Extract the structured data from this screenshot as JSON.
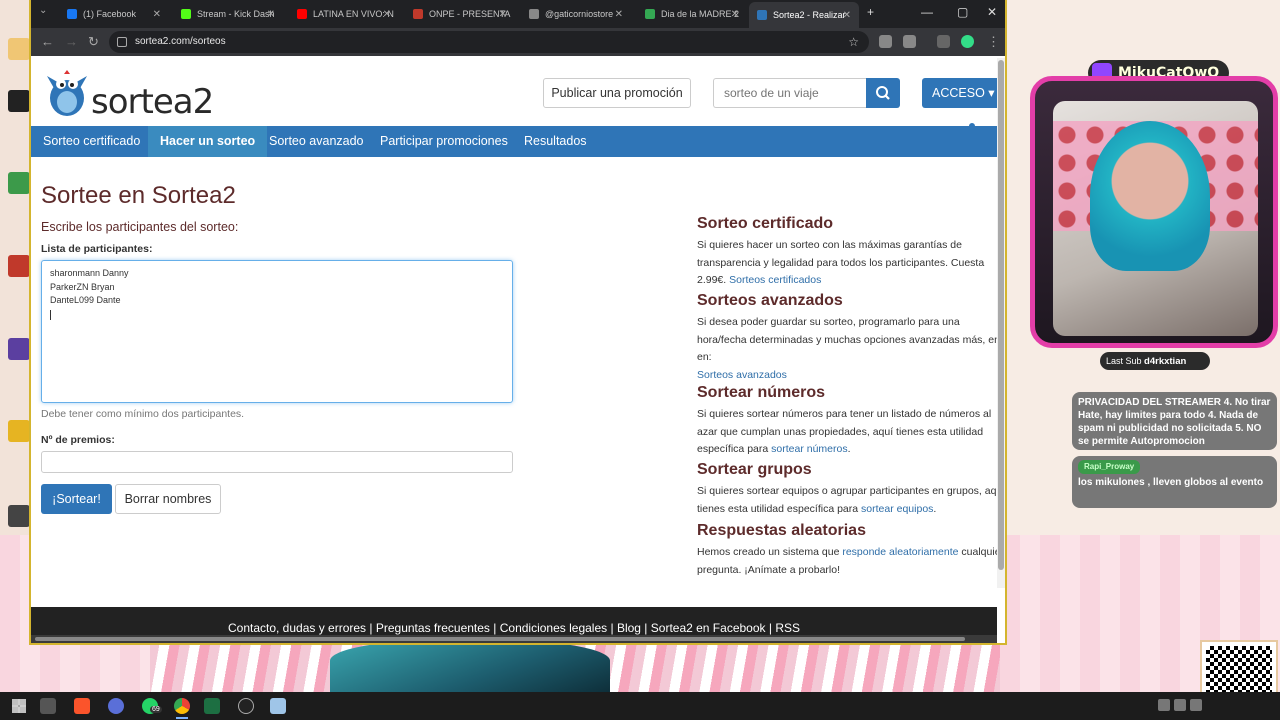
{
  "browser": {
    "tabs": [
      {
        "title": "(1) Facebook",
        "color": "#1877f2"
      },
      {
        "title": "Stream - Kick Dash",
        "color": "#53fc18"
      },
      {
        "title": "LATINA EN VIVO: N",
        "color": "#ff0000"
      },
      {
        "title": "ONPE - PRESENTA",
        "color": "#c0392b"
      },
      {
        "title": "@gaticorniostore",
        "color": "#888888"
      },
      {
        "title": "Dia de la MADRE 2",
        "color": "#34a853"
      },
      {
        "title": "Sortea2 - Realizar",
        "color": "#2f75b7"
      }
    ],
    "url": "sortea2.com/sorteos"
  },
  "site": {
    "logo_text": "sortea2",
    "publish_button": "Publicar una promoción",
    "search_placeholder": "sorteo de un viaje",
    "access_button": "ACCESO ▾",
    "menu": [
      "Sorteo certificado",
      "Hacer un sorteo",
      "Sorteo avanzado",
      "Participar promociones",
      "Resultados"
    ],
    "active_menu": "Hacer un sorteo"
  },
  "form": {
    "title": "Sortee en Sortea2",
    "subtitle": "Escribe los participantes del sorteo:",
    "participants_label": "Lista de participantes:",
    "participants": [
      "sharonmann Danny",
      "ParkerZN Bryan",
      "DanteL099 Dante"
    ],
    "help_text": "Debe tener como mínimo dos participantes.",
    "prizes_label": "Nº de premios:",
    "prizes_value": "",
    "submit_label": "¡Sortear!",
    "clear_label": "Borrar nombres"
  },
  "sidebar": {
    "certified": {
      "title": "Sorteo certificado",
      "l1": "Si quieres hacer un sorteo con las máximas garantías de",
      "l2": "transparencia y legalidad para todos los participantes. Cuesta",
      "l3": "2.99€.",
      "link": "Sorteos certificados"
    },
    "advanced": {
      "title": "Sorteos avanzados",
      "l1": "Si desea poder guardar su sorteo, programarlo para una",
      "l2": "hora/fecha determinadas y muchas opciones avanzadas más, entr",
      "l3": "en:",
      "link": "Sorteos avanzados"
    },
    "numbers": {
      "title": "Sortear números",
      "l1": "Si quieres sortear números para tener un listado de números al",
      "l2": "azar que cumplan unas propiedades, aquí tienes esta utilidad",
      "l3": "específica para",
      "link": "sortear números",
      "end": "."
    },
    "groups": {
      "title": "Sortear grupos",
      "l1": "Si quieres sortear equipos o agrupar participantes en grupos, aqu",
      "l2": "tienes esta utilidad específica para",
      "link": "sortear equipos",
      "end": "."
    },
    "random": {
      "title": "Respuestas aleatorias",
      "l1": "Hemos creado un sistema que",
      "link": "responde aleatoriamente",
      "l1_end": "cualquie",
      "l2": "pregunta. ¡Anímate a probarlo!"
    }
  },
  "footer": {
    "links": [
      "Contacto, dudas y errores",
      "Preguntas frecuentes",
      "Condiciones legales",
      "Blog",
      "Sortea2 en Facebook",
      "RSS"
    ]
  },
  "stream": {
    "channel": "MikuCatOwO",
    "last_sub_label": "Last Sub",
    "last_sub_user": "d4rkxtian",
    "chat_rules": "PRIVACIDAD DEL STREAMER 4. No tirar Hate, hay limites para todo 4. Nada de spam ni publicidad no solicitada 5. NO se permite Autopromocion",
    "chat_user": "Rapi_Proway",
    "chat_message": "los mikulones , lleven globos al evento"
  },
  "taskbar": {
    "whatsapp_badge": "69"
  }
}
